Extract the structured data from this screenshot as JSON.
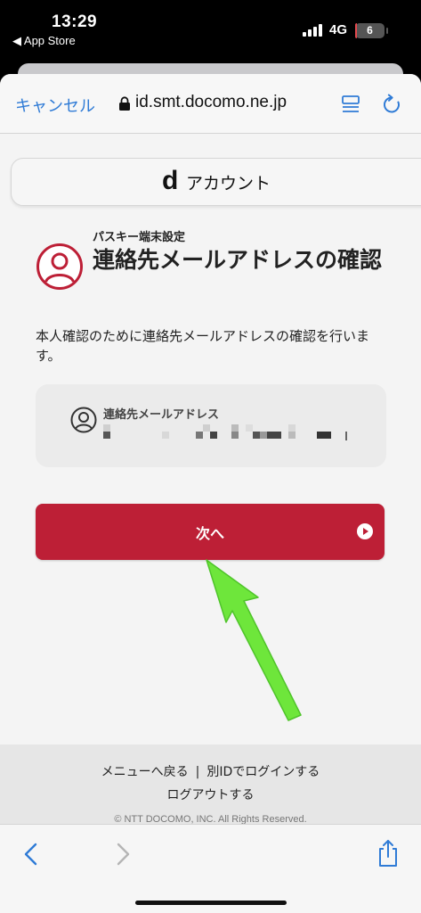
{
  "status": {
    "time": "13:29",
    "back_app": "◀ App Store",
    "network": "4G",
    "battery": "6",
    "battery_level": 0.06
  },
  "browser": {
    "cancel_label": "キャンセル",
    "url": "id.smt.docomo.ne.jp"
  },
  "page": {
    "brand_logo": "d",
    "brand_title": "アカウント",
    "subtitle": "パスキー端末設定",
    "title": "連絡先メールアドレスの確認",
    "description": "本人確認のために連絡先メールアドレスの確認を行います。",
    "email_label": "連絡先メールアドレス",
    "next_label": "次へ"
  },
  "footer": {
    "menu_back": "メニューへ戻る",
    "separator": "|",
    "login_other": "別IDでログインする",
    "logout": "ログアウトする",
    "copyright": "© NTT DOCOMO, INC. All Rights Reserved."
  },
  "colors": {
    "accent_red": "#bd1f36",
    "link_blue": "#2f7bd6",
    "annotation_arrow": "#6ee63b"
  }
}
